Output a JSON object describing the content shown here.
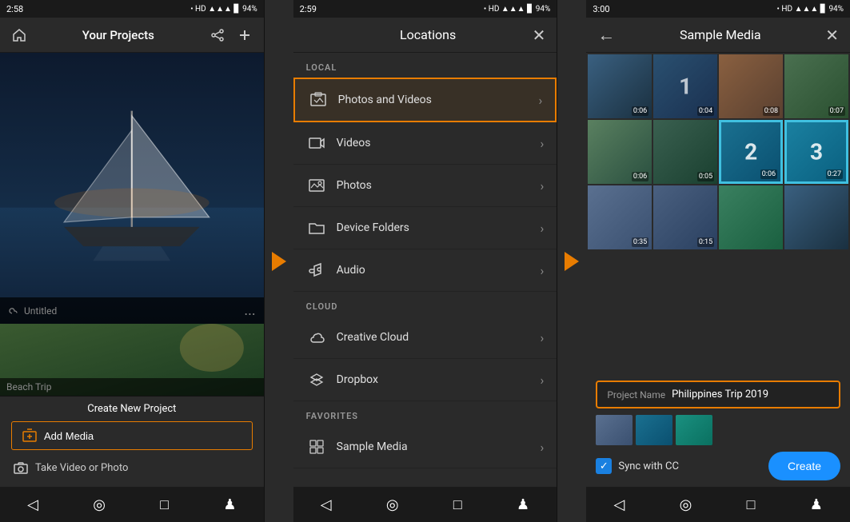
{
  "panel1": {
    "status": {
      "time": "2:58",
      "battery": "94%"
    },
    "header": {
      "title": "Your Projects"
    },
    "projects": [
      {
        "name": "Untitled",
        "more": "..."
      }
    ],
    "footer": {
      "create_label": "Create New Project",
      "add_media_label": "Add Media",
      "take_video_label": "Take Video or Photo"
    }
  },
  "panel2": {
    "status": {
      "time": "2:59",
      "battery": "94%"
    },
    "header": {
      "title": "Locations"
    },
    "sections": {
      "local": {
        "label": "LOCAL",
        "items": [
          {
            "id": "photos-videos",
            "label": "Photos and Videos",
            "highlighted": true
          },
          {
            "id": "videos",
            "label": "Videos",
            "highlighted": false
          },
          {
            "id": "photos",
            "label": "Photos",
            "highlighted": false
          },
          {
            "id": "device-folders",
            "label": "Device Folders",
            "highlighted": false
          },
          {
            "id": "audio",
            "label": "Audio",
            "highlighted": false
          }
        ]
      },
      "cloud": {
        "label": "CLOUD",
        "items": [
          {
            "id": "creative-cloud",
            "label": "Creative Cloud",
            "highlighted": false
          },
          {
            "id": "dropbox",
            "label": "Dropbox",
            "highlighted": false
          }
        ]
      },
      "favorites": {
        "label": "FAVORITES",
        "items": [
          {
            "id": "sample-media",
            "label": "Sample Media",
            "highlighted": false
          }
        ]
      }
    }
  },
  "panel3": {
    "status": {
      "time": "3:00",
      "battery": "94%"
    },
    "header": {
      "title": "Sample Media"
    },
    "media": {
      "row1": [
        {
          "duration": "0:06",
          "selected": false,
          "bg": "thumb-1"
        },
        {
          "duration": "0:04",
          "selected": false,
          "bg": "thumb-2",
          "number": "1"
        },
        {
          "duration": "0:08",
          "selected": false,
          "bg": "thumb-3"
        },
        {
          "duration": "0:07",
          "selected": false,
          "bg": "thumb-4"
        }
      ],
      "row2": [
        {
          "duration": "0:06",
          "selected": false,
          "bg": "thumb-5"
        },
        {
          "duration": "0:05",
          "selected": false,
          "bg": "thumb-6"
        },
        {
          "duration": "0:06",
          "selected": true,
          "bg": "thumb-sel2",
          "number": "2"
        },
        {
          "duration": "0:27",
          "selected": true,
          "bg": "thumb-sel3",
          "number": "3"
        }
      ],
      "row3": [
        {
          "duration": "0:35",
          "selected": false,
          "bg": "thumb-7"
        },
        {
          "duration": "0:15",
          "selected": false,
          "bg": "thumb-8"
        },
        {
          "duration": "",
          "selected": false,
          "bg": "thumb-9"
        },
        {
          "duration": "",
          "selected": false,
          "bg": "thumb-1"
        }
      ]
    },
    "footer": {
      "project_label": "Project Name",
      "project_value": "Philippines Trip 2019",
      "sync_label": "Sync with CC",
      "create_label": "Create"
    }
  },
  "arrows": {
    "right": "▶"
  },
  "icons": {
    "back": "←",
    "close": "✕",
    "chevron": "›",
    "home": "⌂",
    "circle": "○",
    "square": "□",
    "person": "♟",
    "check": "✓",
    "camera": "📷",
    "folder": "📁",
    "music": "♪",
    "grid": "⊞",
    "photos": "🖼",
    "cloud": "☁",
    "dropbox": "⬡"
  }
}
